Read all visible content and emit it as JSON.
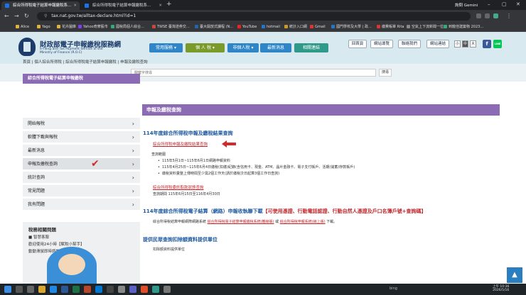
{
  "browser": {
    "tabs": [
      {
        "title": "綜合所得稅電子結算申報繳稅系…"
      },
      {
        "title": "綜合所得稅電子結算申報繳稅系…"
      }
    ],
    "gemini_label": "詢問 Gemini",
    "url": "tax.nat.gov.tw/alltax-declare.html?id=1",
    "bookmarks": [
      "Alice",
      "Yago",
      "花卉圖庫",
      "Yahoo奇摩股市",
      "國稅局個人綜合…",
      "TWSE 臺灣證券交…",
      "臺大開放式課程 (N…",
      "YouTube",
      "hotmail",
      "統計入口網",
      "Gmail",
      "國門學校及大學 | 政…",
      "繳費帳單 Rita",
      "空氣上下流新聞一位…",
      "到龍佳建築物 2023…"
    ]
  },
  "site": {
    "title": "財政部電子申報繳稅服務網",
    "subtitle_lines": [
      "e-Filing and Tax Payment Service of the",
      "Ministry of Finance (R.O.C)"
    ],
    "nav": [
      {
        "label": "常用服務 ▾",
        "color": "#2e86c8"
      },
      {
        "label": "個 人 稅 ▾",
        "color": "#7a9a2a"
      },
      {
        "label": "非個人稅 ▾",
        "color": "#2e86c8"
      },
      {
        "label": "最新消息",
        "color": "#2e86c8"
      },
      {
        "label": "相關連結",
        "color": "#2f9a8a"
      }
    ],
    "top_links": [
      "回首頁",
      "網站導覽",
      "聯絡我們",
      "網站連結"
    ],
    "font_sizes": [
      "小",
      "中",
      "大"
    ],
    "social": [
      "f",
      "LINE"
    ],
    "search_placeholder": "關鍵字搜尋",
    "search_button": "搜尋"
  },
  "breadcrumb": [
    "首頁",
    "個人綜合所得稅",
    "綜合所得稅電子結算申報繳稅",
    "申報及繳稅查詢"
  ],
  "sidebar": {
    "title": "綜合所得稅電子結算申報繳稅",
    "items": [
      {
        "label": "開始報稅"
      },
      {
        "label": "軟體下載與報稅"
      },
      {
        "label": "最新消息"
      },
      {
        "label": "申報及繳稅查詢"
      },
      {
        "label": "統計查詢"
      },
      {
        "label": "常見問題"
      },
      {
        "label": "我有問題"
      }
    ],
    "related_title": "稅務相關問題",
    "related_lines": [
      "■ 智慧客服",
      "歡迎使用24小時【賦稅小幫手】",
      "動動滑鼠即時諮詢"
    ]
  },
  "main": {
    "title": "申報及繳稅查詢",
    "section1": {
      "heading": "114年度綜合所得稅申報及繳稅結果查詢",
      "link": "綜合所得稅申報及繳稅結果查詢",
      "range_label": "查詢範圍",
      "bullets": [
        "115年5月1日~115年6月1日網路申報資料",
        "115年4月25日~115年6月4日繳稅(扣繳)紀錄(含信用卡、現金、ATM、晶片金融卡、電子支付帳戶、活期(儲蓄)存款帳戶)",
        "繳稅資料彙整上傳時間至少需2個工作天(請於繳稅次日起算3個工作日查詢)"
      ],
      "link2": "綜合所得稅委託取款狀態查詢",
      "period": "查詢期間 115年6月15日至116年4月30日"
    },
    "section2": {
      "heading_blue": "114年度綜合所得稅電子結算（網路）申報收執聯下載",
      "heading_red": "【可使用憑證、行動電話認證、行動自然人憑證及戶口名簿戶號+查詢碼】",
      "text_before": "綜合所得稅結算申報網際網路系統",
      "link_a": "綜合所得稅電子結算申報繳稅系統(離線版)",
      "text_mid": "或",
      "link_b": "綜合所得稅申報系統(線上版)",
      "text_after": "下載。"
    },
    "section3": {
      "heading": "提供民眾查詢扣除額資料提供單位",
      "text": "扣除額資料提供單位"
    }
  },
  "taskbar": {
    "search": "bing",
    "time": "上午 10:36",
    "date": "2026/5/16"
  }
}
